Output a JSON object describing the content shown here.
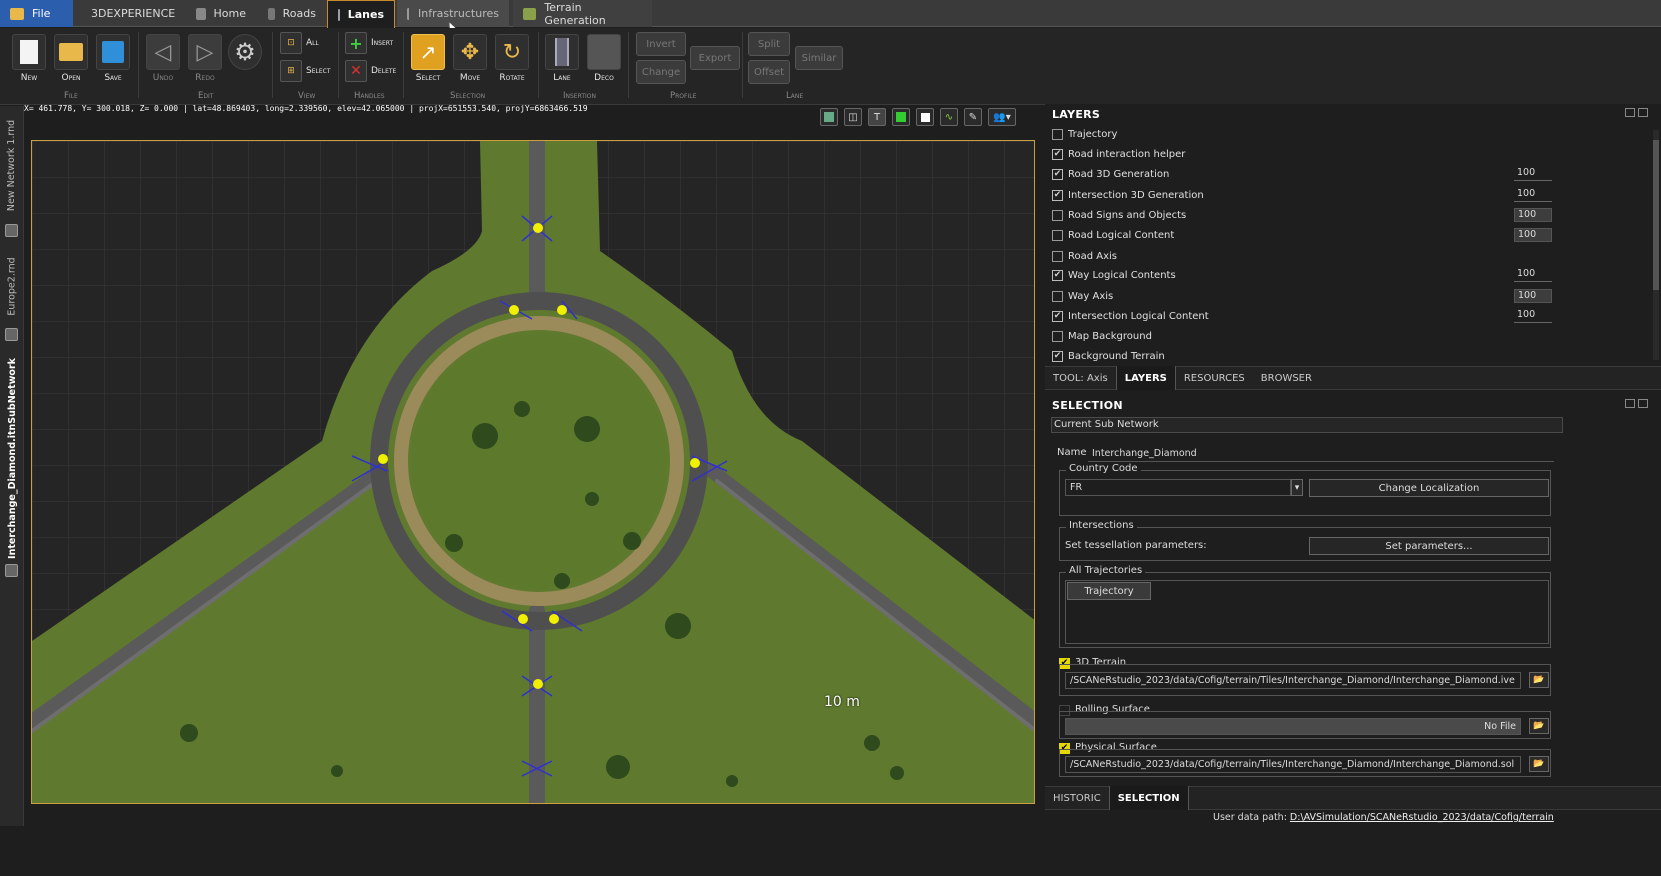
{
  "tabs": [
    {
      "label": "File",
      "icon": "folder-icon"
    },
    {
      "label": "3DEXPERIENCE",
      "icon": "globe-icon"
    },
    {
      "label": "Home",
      "icon": "home-icon"
    },
    {
      "label": "Roads",
      "icon": "road-icon"
    },
    {
      "label": "Lanes",
      "icon": "lanes-icon"
    },
    {
      "label": "Infrastructures",
      "icon": "pin-icon"
    },
    {
      "label": "Terrain Generation",
      "icon": "terrain-icon"
    }
  ],
  "toolbar": {
    "new": "New",
    "open": "Open",
    "save": "Save",
    "undo": "Undo",
    "redo": "Redo",
    "view_all": "All",
    "view_select": "Select",
    "insert": "Insert",
    "delete": "Delete",
    "select": "Select",
    "move": "Move",
    "rotate": "Rotate",
    "lane": "Lane",
    "deco": "Deco",
    "invert": "Invert",
    "export": "Export",
    "change": "Change",
    "split": "Split",
    "similar": "Similar",
    "offset": "Offset",
    "groups": {
      "file": "File",
      "edit": "Edit",
      "view": "View",
      "handles": "Handles",
      "selection": "Selection",
      "insertion": "Insertion",
      "profile": "Profile",
      "lane": "Lane"
    }
  },
  "vertical_tabs": [
    "New Network 1.rnd",
    "Europe2.rnd",
    "Interchange_Diamond.itnSubNetwork"
  ],
  "coords": "X= 461.778, Y= 300.018, Z=   0.000 | lat=48.869403, long=2.339560, elev=42.065000 | projX=651553.540, projY=6863466.519",
  "viewport": {
    "scale_label": "10 m",
    "view_buttons": [
      "T"
    ]
  },
  "layers": {
    "title": "LAYERS",
    "items": [
      {
        "label": "Trajectory",
        "checked": false,
        "value": null
      },
      {
        "label": "Road interaction helper",
        "checked": true,
        "value": null
      },
      {
        "label": "Road 3D Generation",
        "checked": true,
        "value": "100"
      },
      {
        "label": "Intersection 3D Generation",
        "checked": true,
        "value": "100"
      },
      {
        "label": "Road Signs and Objects",
        "checked": false,
        "value": "100"
      },
      {
        "label": "Road Logical Content",
        "checked": false,
        "value": "100"
      },
      {
        "label": "Road Axis",
        "checked": false,
        "value": null
      },
      {
        "label": "Way Logical Contents",
        "checked": true,
        "value": "100"
      },
      {
        "label": "Way Axis",
        "checked": false,
        "value": "100"
      },
      {
        "label": "Intersection Logical Content",
        "checked": true,
        "value": "100"
      },
      {
        "label": "Map Background",
        "checked": false,
        "value": null
      },
      {
        "label": "Background Terrain",
        "checked": true,
        "value": null
      }
    ]
  },
  "panel_tabs": {
    "tool": "TOOL: Axis",
    "layers": "LAYERS",
    "resources": "RESOURCES",
    "browser": "BROWSER"
  },
  "selection": {
    "title": "SELECTION",
    "current": "Current Sub Network",
    "name_label": "Name",
    "name_value": "Interchange_Diamond",
    "country_legend": "Country Code",
    "country_value": "FR",
    "change_localization": "Change Localization",
    "intersections_legend": "Intersections",
    "tessellation_label": "Set tessellation parameters:",
    "set_parameters": "Set parameters...",
    "trajectories_legend": "All Trajectories",
    "trajectory_item": "Trajectory",
    "terrain_label": "3D Terrain",
    "terrain_path": "/SCANeRstudio_2023/data/Cofig/terrain/Tiles/Interchange_Diamond/Interchange_Diamond.ive",
    "rolling_label": "Rolling Surface",
    "rolling_value": "No File",
    "physical_label": "Physical Surface",
    "physical_path": "/SCANeRstudio_2023/data/Cofig/terrain/Tiles/Interchange_Diamond/Interchange_Diamond.sol"
  },
  "bottom_tabs": {
    "historic": "HISTORIC",
    "selection": "SELECTION"
  },
  "status": {
    "user_path_label": "User data path:",
    "user_path": "D:\\AVSimulation/SCANeRstudio_2023/data/Cofig/terrain"
  },
  "colors": {
    "accent": "#c88a2e",
    "file_tab": "#2b5fae",
    "grass": "#5f7a2e",
    "asphalt": "#5a5a5a",
    "handle": "#f0f000"
  }
}
